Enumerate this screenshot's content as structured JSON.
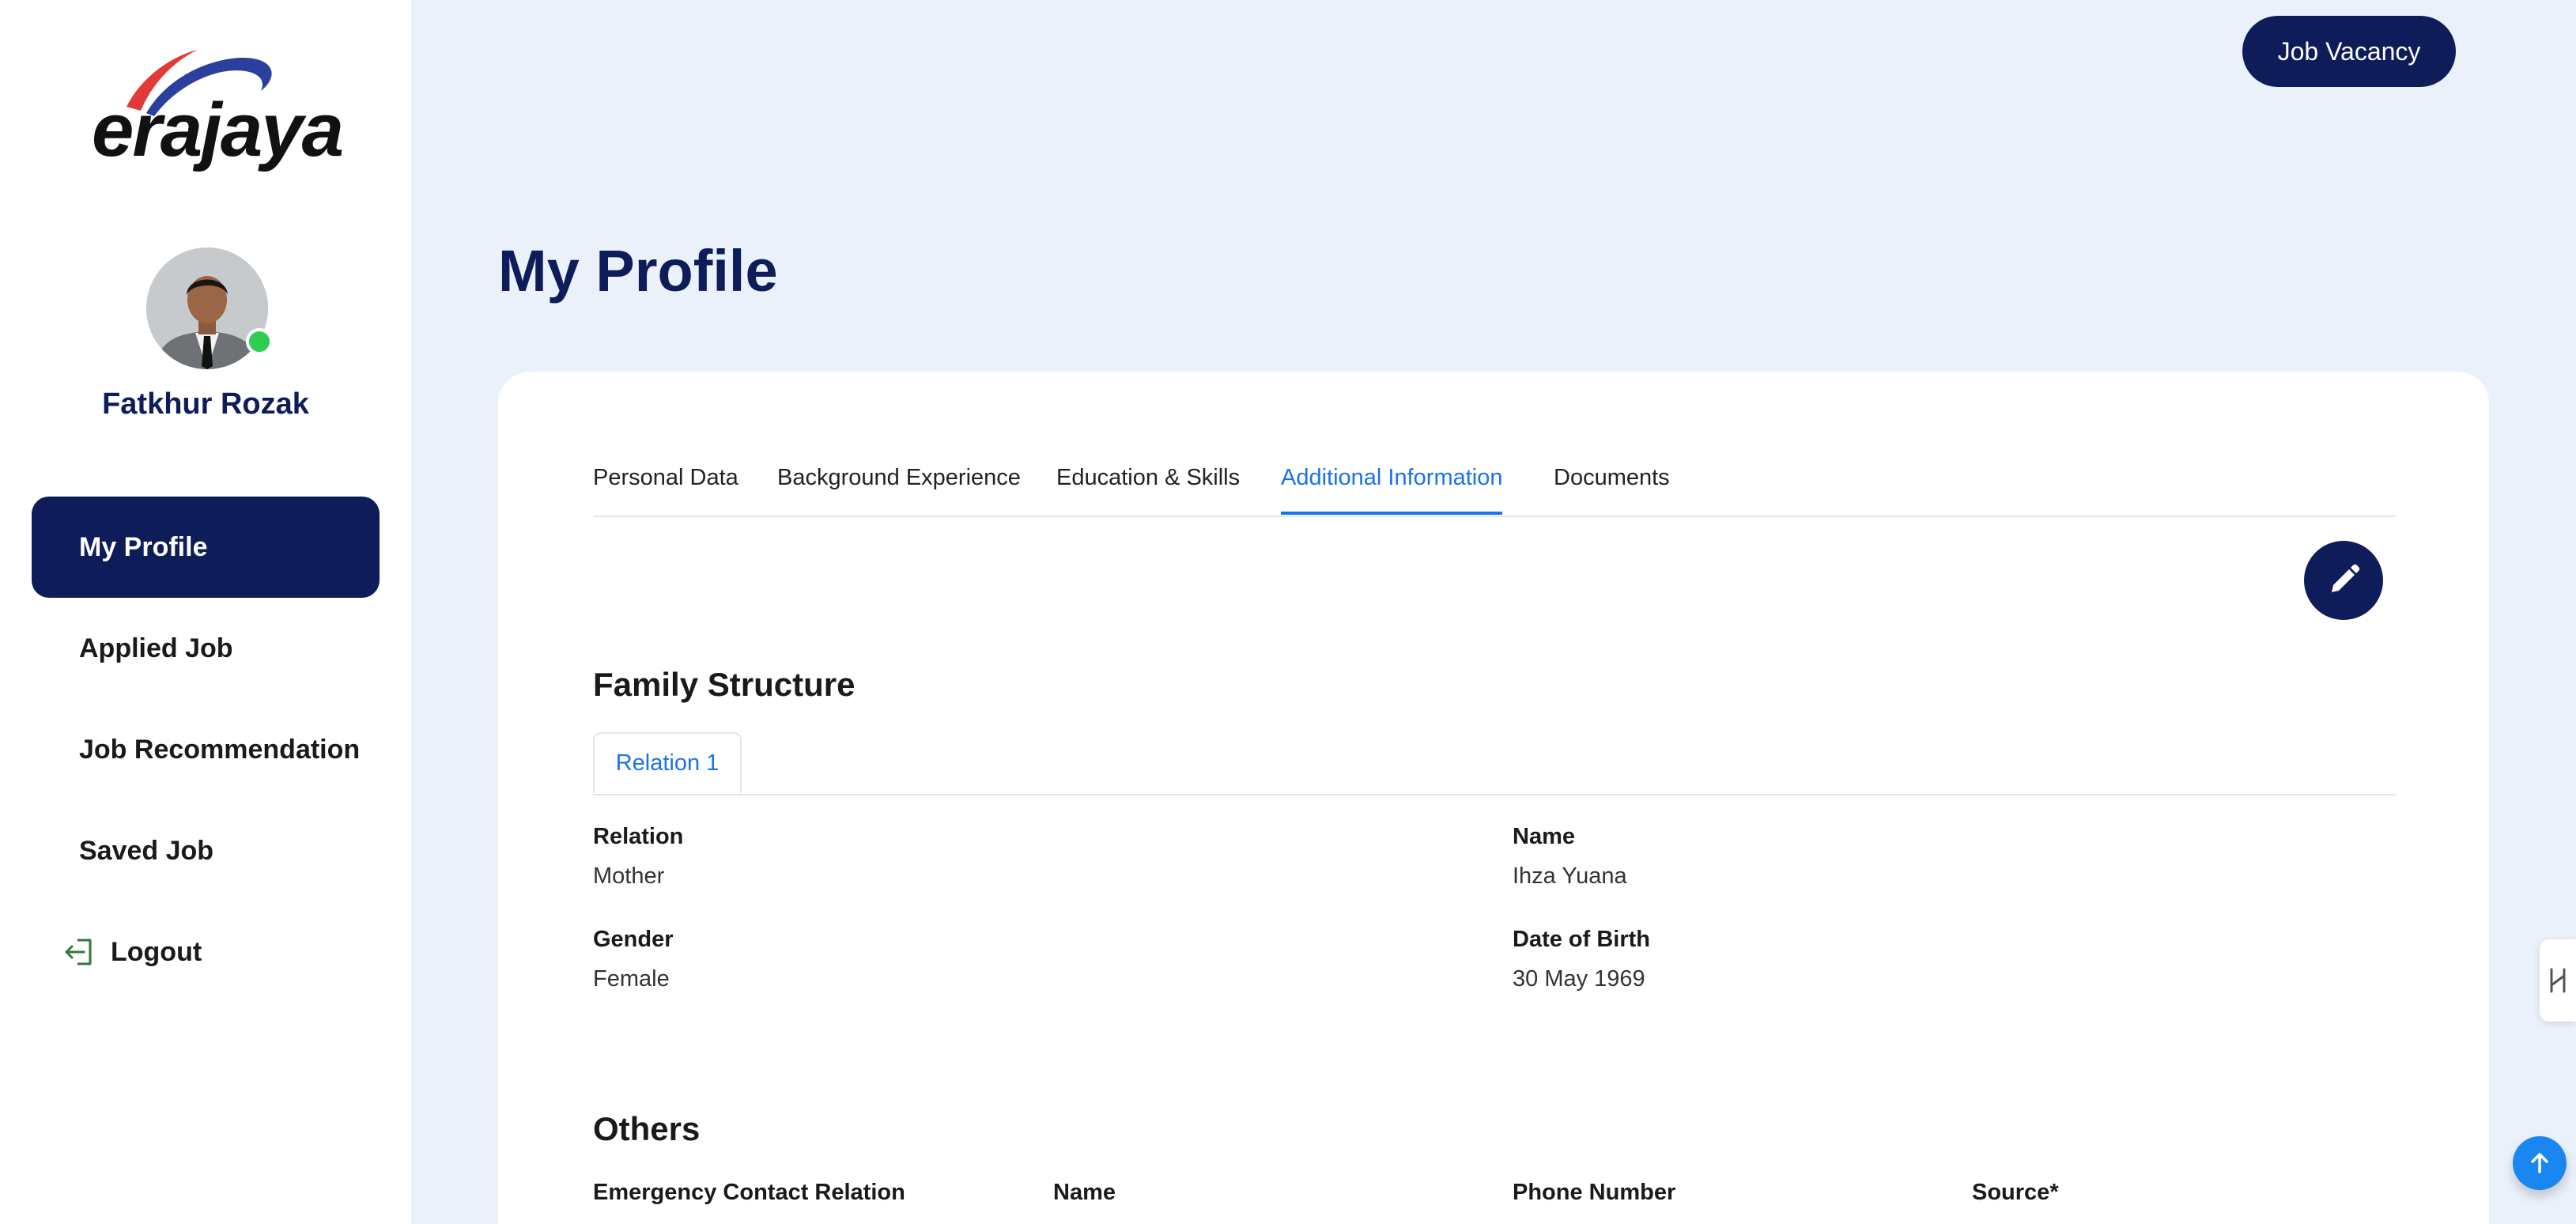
{
  "brand": {
    "logo_text": "erajaya",
    "colors": {
      "navy": "#0f1c5a",
      "accent_blue": "#1a73e8",
      "background": "#eaf1fb",
      "online": "#2ecc53",
      "logo_red": "#e23a3a",
      "logo_blue": "#2b3f9e"
    }
  },
  "user": {
    "name": "Fatkhur Rozak",
    "status": "online"
  },
  "sidebar": {
    "items": [
      {
        "label": "My Profile",
        "active": true
      },
      {
        "label": "Applied Job",
        "active": false
      },
      {
        "label": "Job Recommendation",
        "active": false
      },
      {
        "label": "Saved Job",
        "active": false
      },
      {
        "label": "Logout",
        "icon": "logout-icon",
        "active": false
      }
    ]
  },
  "header": {
    "job_vacancy_label": "Job Vacancy"
  },
  "page": {
    "title": "My Profile"
  },
  "tabs": [
    {
      "label": "Personal Data",
      "active": false
    },
    {
      "label": "Background Experience",
      "active": false
    },
    {
      "label": "Education & Skills",
      "active": false
    },
    {
      "label": "Additional Information",
      "active": true
    },
    {
      "label": "Documents",
      "active": false
    }
  ],
  "edit_button": {
    "icon": "pencil-icon"
  },
  "family_structure": {
    "title": "Family Structure",
    "subtabs": [
      {
        "label": "Relation 1",
        "active": true
      }
    ],
    "fields": {
      "relation": {
        "label": "Relation",
        "value": "Mother"
      },
      "name": {
        "label": "Name",
        "value": "Ihza Yuana"
      },
      "gender": {
        "label": "Gender",
        "value": "Female"
      },
      "dob": {
        "label": "Date of Birth",
        "value": "30 May 1969"
      }
    }
  },
  "others": {
    "title": "Others",
    "columns": [
      "Emergency Contact Relation",
      "Name",
      "Phone Number",
      "Source*"
    ]
  },
  "widgets": {
    "side_widget_icon": "collapse-handle-icon",
    "scroll_top_icon": "arrow-up-icon"
  }
}
